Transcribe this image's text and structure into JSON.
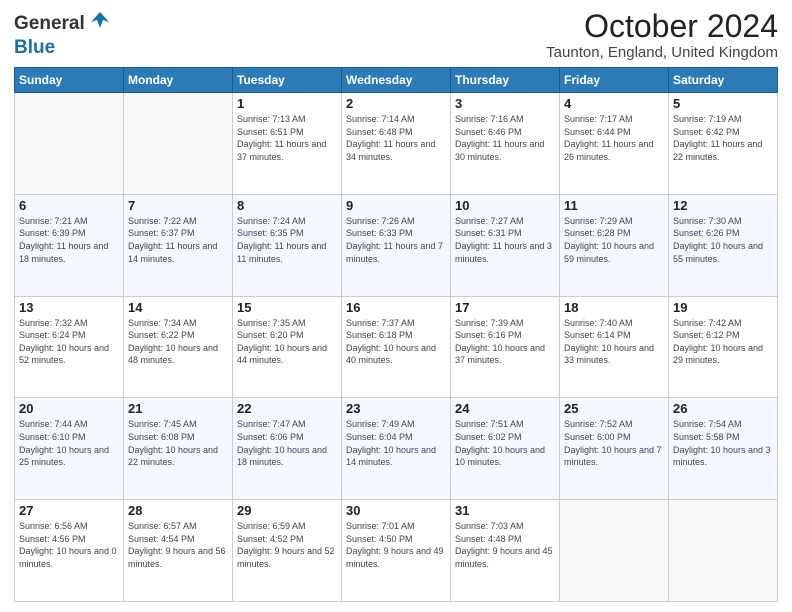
{
  "header": {
    "logo_general": "General",
    "logo_blue": "Blue",
    "month": "October 2024",
    "location": "Taunton, England, United Kingdom"
  },
  "days_of_week": [
    "Sunday",
    "Monday",
    "Tuesday",
    "Wednesday",
    "Thursday",
    "Friday",
    "Saturday"
  ],
  "weeks": [
    [
      {
        "day": "",
        "sunrise": "",
        "sunset": "",
        "daylight": ""
      },
      {
        "day": "",
        "sunrise": "",
        "sunset": "",
        "daylight": ""
      },
      {
        "day": "1",
        "sunrise": "Sunrise: 7:13 AM",
        "sunset": "Sunset: 6:51 PM",
        "daylight": "Daylight: 11 hours and 37 minutes."
      },
      {
        "day": "2",
        "sunrise": "Sunrise: 7:14 AM",
        "sunset": "Sunset: 6:48 PM",
        "daylight": "Daylight: 11 hours and 34 minutes."
      },
      {
        "day": "3",
        "sunrise": "Sunrise: 7:16 AM",
        "sunset": "Sunset: 6:46 PM",
        "daylight": "Daylight: 11 hours and 30 minutes."
      },
      {
        "day": "4",
        "sunrise": "Sunrise: 7:17 AM",
        "sunset": "Sunset: 6:44 PM",
        "daylight": "Daylight: 11 hours and 26 minutes."
      },
      {
        "day": "5",
        "sunrise": "Sunrise: 7:19 AM",
        "sunset": "Sunset: 6:42 PM",
        "daylight": "Daylight: 11 hours and 22 minutes."
      }
    ],
    [
      {
        "day": "6",
        "sunrise": "Sunrise: 7:21 AM",
        "sunset": "Sunset: 6:39 PM",
        "daylight": "Daylight: 11 hours and 18 minutes."
      },
      {
        "day": "7",
        "sunrise": "Sunrise: 7:22 AM",
        "sunset": "Sunset: 6:37 PM",
        "daylight": "Daylight: 11 hours and 14 minutes."
      },
      {
        "day": "8",
        "sunrise": "Sunrise: 7:24 AM",
        "sunset": "Sunset: 6:35 PM",
        "daylight": "Daylight: 11 hours and 11 minutes."
      },
      {
        "day": "9",
        "sunrise": "Sunrise: 7:26 AM",
        "sunset": "Sunset: 6:33 PM",
        "daylight": "Daylight: 11 hours and 7 minutes."
      },
      {
        "day": "10",
        "sunrise": "Sunrise: 7:27 AM",
        "sunset": "Sunset: 6:31 PM",
        "daylight": "Daylight: 11 hours and 3 minutes."
      },
      {
        "day": "11",
        "sunrise": "Sunrise: 7:29 AM",
        "sunset": "Sunset: 6:28 PM",
        "daylight": "Daylight: 10 hours and 59 minutes."
      },
      {
        "day": "12",
        "sunrise": "Sunrise: 7:30 AM",
        "sunset": "Sunset: 6:26 PM",
        "daylight": "Daylight: 10 hours and 55 minutes."
      }
    ],
    [
      {
        "day": "13",
        "sunrise": "Sunrise: 7:32 AM",
        "sunset": "Sunset: 6:24 PM",
        "daylight": "Daylight: 10 hours and 52 minutes."
      },
      {
        "day": "14",
        "sunrise": "Sunrise: 7:34 AM",
        "sunset": "Sunset: 6:22 PM",
        "daylight": "Daylight: 10 hours and 48 minutes."
      },
      {
        "day": "15",
        "sunrise": "Sunrise: 7:35 AM",
        "sunset": "Sunset: 6:20 PM",
        "daylight": "Daylight: 10 hours and 44 minutes."
      },
      {
        "day": "16",
        "sunrise": "Sunrise: 7:37 AM",
        "sunset": "Sunset: 6:18 PM",
        "daylight": "Daylight: 10 hours and 40 minutes."
      },
      {
        "day": "17",
        "sunrise": "Sunrise: 7:39 AM",
        "sunset": "Sunset: 6:16 PM",
        "daylight": "Daylight: 10 hours and 37 minutes."
      },
      {
        "day": "18",
        "sunrise": "Sunrise: 7:40 AM",
        "sunset": "Sunset: 6:14 PM",
        "daylight": "Daylight: 10 hours and 33 minutes."
      },
      {
        "day": "19",
        "sunrise": "Sunrise: 7:42 AM",
        "sunset": "Sunset: 6:12 PM",
        "daylight": "Daylight: 10 hours and 29 minutes."
      }
    ],
    [
      {
        "day": "20",
        "sunrise": "Sunrise: 7:44 AM",
        "sunset": "Sunset: 6:10 PM",
        "daylight": "Daylight: 10 hours and 25 minutes."
      },
      {
        "day": "21",
        "sunrise": "Sunrise: 7:45 AM",
        "sunset": "Sunset: 6:08 PM",
        "daylight": "Daylight: 10 hours and 22 minutes."
      },
      {
        "day": "22",
        "sunrise": "Sunrise: 7:47 AM",
        "sunset": "Sunset: 6:06 PM",
        "daylight": "Daylight: 10 hours and 18 minutes."
      },
      {
        "day": "23",
        "sunrise": "Sunrise: 7:49 AM",
        "sunset": "Sunset: 6:04 PM",
        "daylight": "Daylight: 10 hours and 14 minutes."
      },
      {
        "day": "24",
        "sunrise": "Sunrise: 7:51 AM",
        "sunset": "Sunset: 6:02 PM",
        "daylight": "Daylight: 10 hours and 10 minutes."
      },
      {
        "day": "25",
        "sunrise": "Sunrise: 7:52 AM",
        "sunset": "Sunset: 6:00 PM",
        "daylight": "Daylight: 10 hours and 7 minutes."
      },
      {
        "day": "26",
        "sunrise": "Sunrise: 7:54 AM",
        "sunset": "Sunset: 5:58 PM",
        "daylight": "Daylight: 10 hours and 3 minutes."
      }
    ],
    [
      {
        "day": "27",
        "sunrise": "Sunrise: 6:56 AM",
        "sunset": "Sunset: 4:56 PM",
        "daylight": "Daylight: 10 hours and 0 minutes."
      },
      {
        "day": "28",
        "sunrise": "Sunrise: 6:57 AM",
        "sunset": "Sunset: 4:54 PM",
        "daylight": "Daylight: 9 hours and 56 minutes."
      },
      {
        "day": "29",
        "sunrise": "Sunrise: 6:59 AM",
        "sunset": "Sunset: 4:52 PM",
        "daylight": "Daylight: 9 hours and 52 minutes."
      },
      {
        "day": "30",
        "sunrise": "Sunrise: 7:01 AM",
        "sunset": "Sunset: 4:50 PM",
        "daylight": "Daylight: 9 hours and 49 minutes."
      },
      {
        "day": "31",
        "sunrise": "Sunrise: 7:03 AM",
        "sunset": "Sunset: 4:48 PM",
        "daylight": "Daylight: 9 hours and 45 minutes."
      },
      {
        "day": "",
        "sunrise": "",
        "sunset": "",
        "daylight": ""
      },
      {
        "day": "",
        "sunrise": "",
        "sunset": "",
        "daylight": ""
      }
    ]
  ]
}
